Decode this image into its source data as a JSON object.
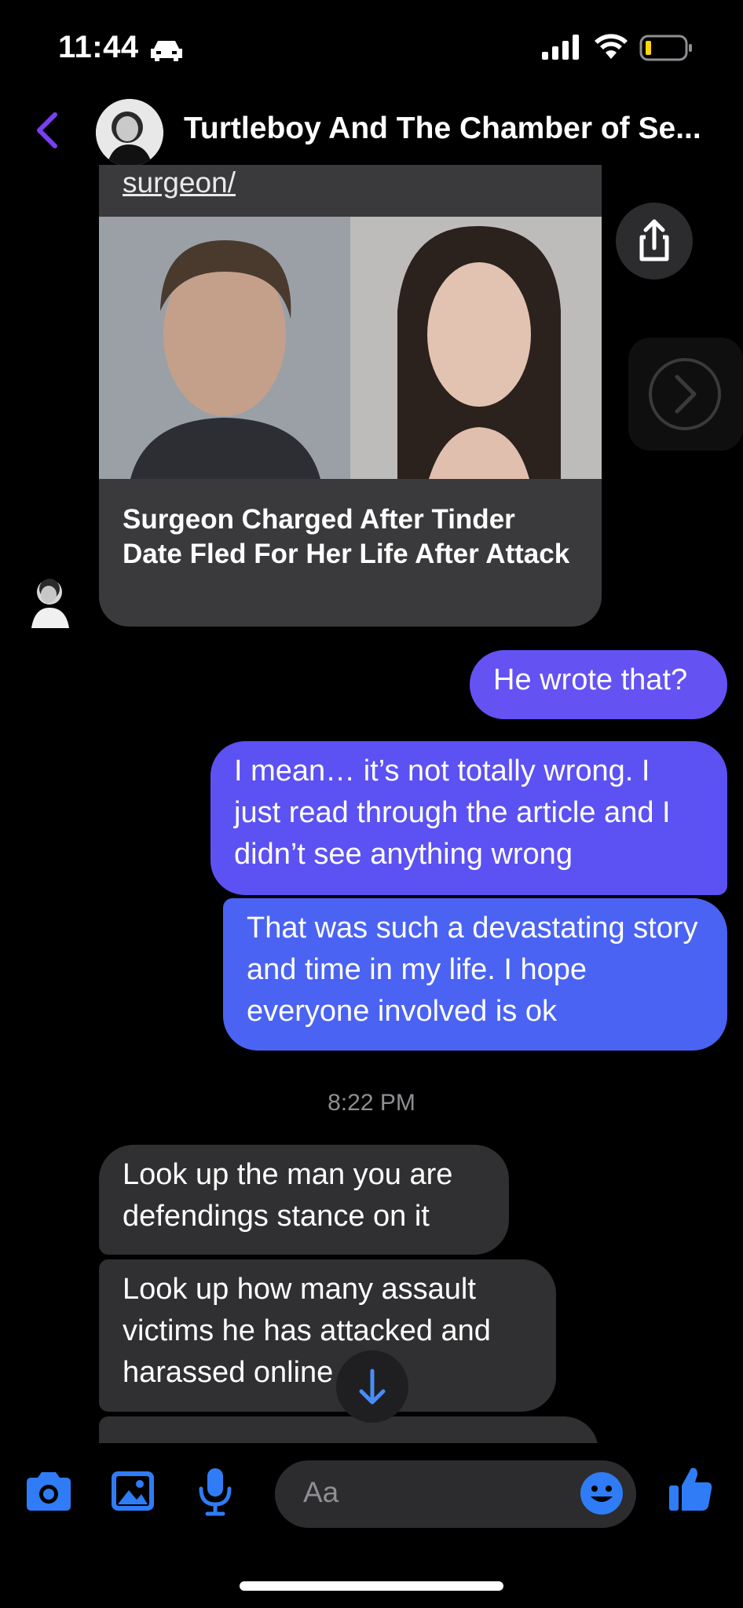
{
  "status_bar": {
    "time": "11:44",
    "icons": [
      "car-icon",
      "cellular-signal-icon",
      "wifi-icon",
      "battery-low-icon"
    ]
  },
  "header": {
    "back_icon": "chevron-left-icon",
    "title": "Turtleboy And The Chamber of Se...",
    "accent_color": "#7b3ff2"
  },
  "link_card": {
    "url_text": "surgeon/",
    "headline": "Surgeon Charged After Tinder Date Fled For Her Life After Attack",
    "share_icon": "share-icon",
    "next_icon": "chevron-right-icon"
  },
  "messages": [
    {
      "direction": "outgoing",
      "text": "He wrote that?"
    },
    {
      "direction": "outgoing",
      "text": "I mean… it’s not totally wrong. I just read through the article and I didn’t see anything wrong"
    },
    {
      "direction": "outgoing",
      "text": "That was such a devastating story and time in my life. I hope everyone involved is ok"
    },
    {
      "direction": "incoming",
      "text": "Look up the man you are defendings stance on it"
    },
    {
      "direction": "incoming",
      "text": "Look up how many assault victims he has attacked and harassed online"
    }
  ],
  "timestamp": "8:22 PM",
  "composer": {
    "placeholder": "Aa",
    "icons": [
      "camera-icon",
      "photo-icon",
      "microphone-icon",
      "emoji-icon",
      "thumbs-up-icon"
    ],
    "icon_color": "#2f7cf6"
  },
  "colors": {
    "outgoing_bubble": "#5a55f0",
    "incoming_bubble": "#303032",
    "background": "#000000"
  }
}
